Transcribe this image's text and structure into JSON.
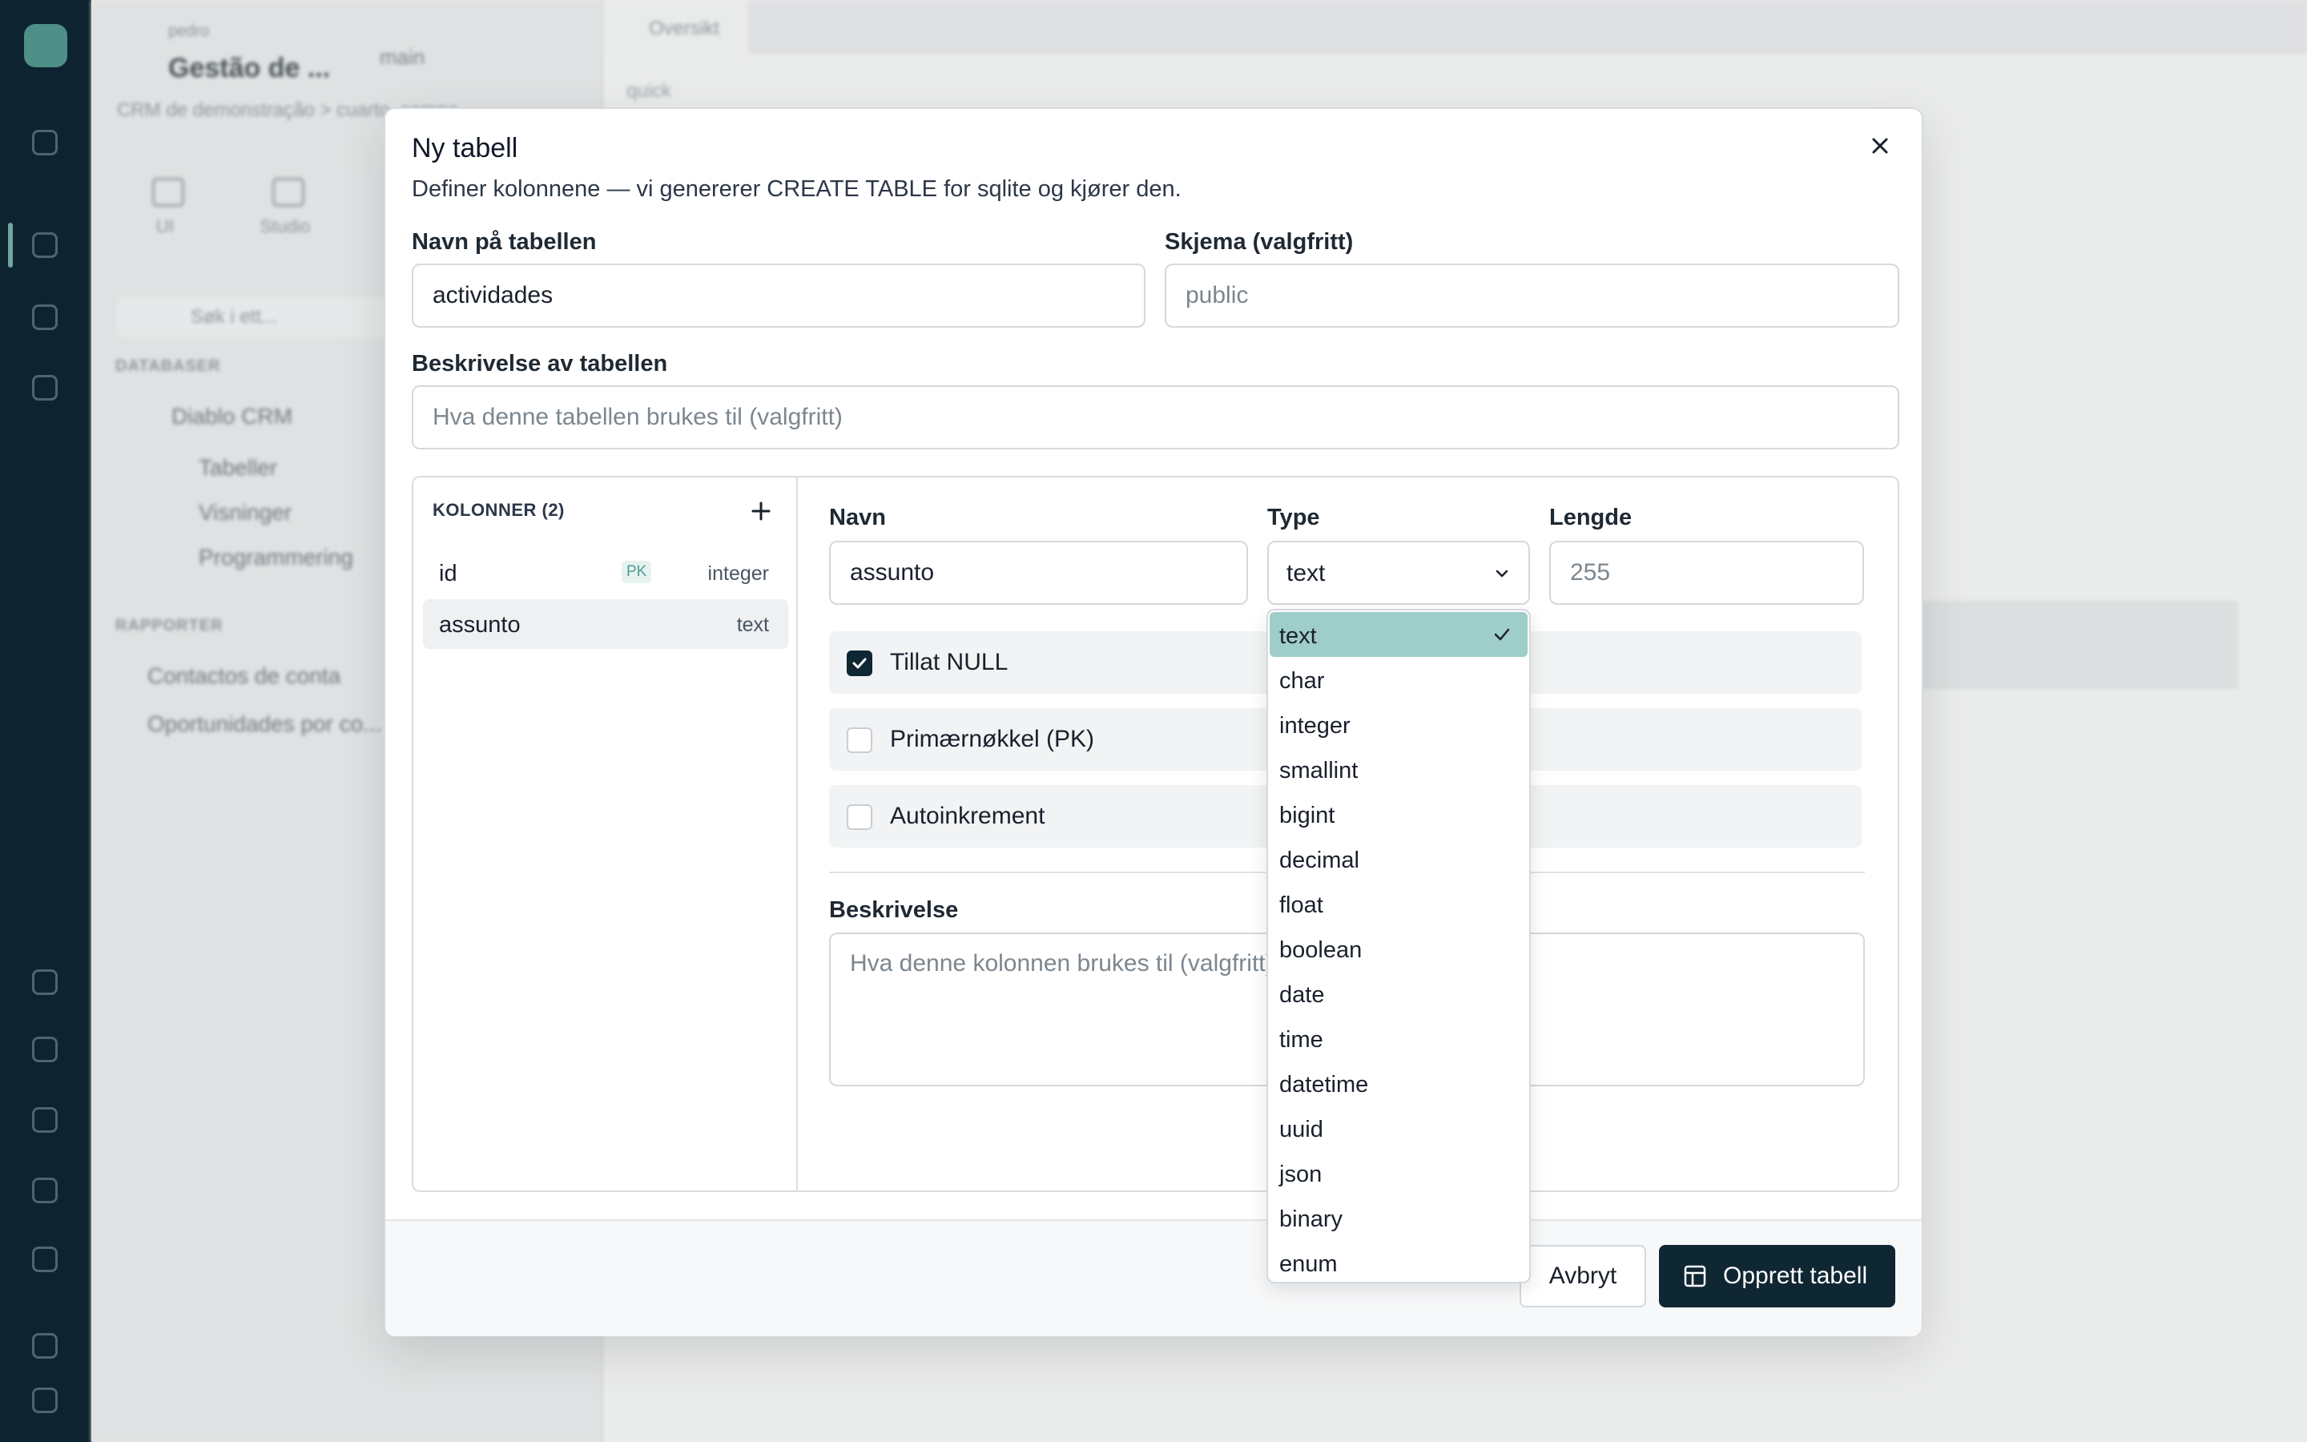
{
  "background": {
    "sidebar": {
      "org": "pedro",
      "project": "Gestão de ...",
      "branch": "main",
      "crumb": "CRM de demonstração > cuarto_campo...",
      "tabs": [
        "UI",
        "Studio",
        ""
      ],
      "search_placeholder": "Søk i ett...",
      "section_database": "DATABASER",
      "tree": [
        "Diablo CRM",
        "Tabeller",
        "Visninger",
        "Programmering"
      ],
      "section_reports": "RAPPORTER",
      "reports": [
        "Contactos de conta",
        "Oportunidades por co..."
      ]
    },
    "main": {
      "tab_label": "Oversikt",
      "label": "quick"
    }
  },
  "modal": {
    "title": "Ny tabell",
    "subtitle": "Definer kolonnene — vi genererer CREATE TABLE for sqlite og kjører den.",
    "table_name_label": "Navn på tabellen",
    "table_name_value": "actividades",
    "schema_label": "Skjema (valgfritt)",
    "schema_placeholder": "public",
    "table_desc_label": "Beskrivelse av tabellen",
    "table_desc_placeholder": "Hva denne tabellen brukes til (valgfritt)",
    "columns_header": "KOLONNER (2)",
    "columns": [
      {
        "name": "id",
        "pk": "PK",
        "type": "integer"
      },
      {
        "name": "assunto",
        "pk": "",
        "type": "text"
      }
    ],
    "detail": {
      "name_label": "Navn",
      "name_value": "assunto",
      "type_label": "Type",
      "type_value": "text",
      "length_label": "Lengde",
      "length_placeholder": "255",
      "allow_null": "Tillat NULL",
      "allow_null_checked": true,
      "primary_key": "Primærnøkkel (PK)",
      "primary_key_checked": false,
      "autoincrement": "Autoinkrement",
      "autoincrement_checked": false,
      "desc_label": "Beskrivelse",
      "desc_placeholder": "Hva denne kolonnen brukes til (valgfritt)"
    },
    "type_options": [
      "text",
      "char",
      "integer",
      "smallint",
      "bigint",
      "decimal",
      "float",
      "boolean",
      "date",
      "time",
      "datetime",
      "uuid",
      "json",
      "binary",
      "enum"
    ],
    "selected_type": "text",
    "cancel_label": "Avbryt",
    "create_label": "Opprett tabell"
  },
  "colors": {
    "primary": "#0f2633",
    "selected_option": "#9fcdc7",
    "rail": "#0d2430"
  }
}
